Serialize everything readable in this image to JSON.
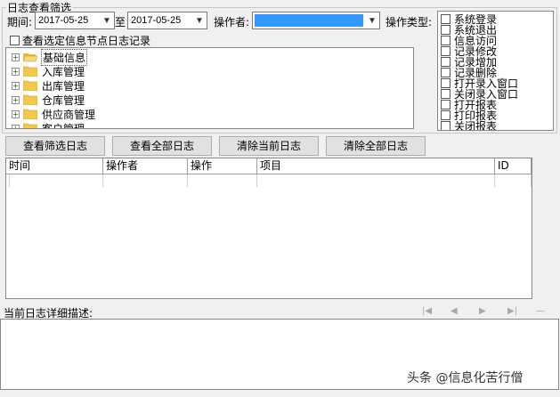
{
  "filter": {
    "group_title": "日志查看筛选",
    "period_label": "期间:",
    "start_date": "2017-05-25",
    "to_label": "至",
    "end_date": "2017-05-25",
    "operator_label": "操作者:",
    "operator_value": "",
    "op_type_label": "操作类型:",
    "node_log_label": "查看选定信息节点日志记录"
  },
  "tree": {
    "items": [
      {
        "label": "基础信息",
        "selected": true
      },
      {
        "label": "入库管理"
      },
      {
        "label": "出库管理"
      },
      {
        "label": "仓库管理"
      },
      {
        "label": "供应商管理"
      },
      {
        "label": "客户管理"
      }
    ]
  },
  "op_types": [
    "系统登录",
    "系统退出",
    "信息访问",
    "记录修改",
    "记录增加",
    "记录删除",
    "打开录入窗口",
    "关闭录入窗口",
    "打开报表",
    "打印报表",
    "关闭报表"
  ],
  "buttons": {
    "view_filtered": "查看筛选日志",
    "view_all": "查看全部日志",
    "clear_current": "清除当前日志",
    "clear_all": "清除全部日志"
  },
  "grid": {
    "columns": [
      "时间",
      "操作者",
      "操作",
      "项目",
      "ID"
    ]
  },
  "detail": {
    "label": "当前日志详细描述:"
  },
  "colors": {
    "operator_highlight": "#3399ff",
    "folder": "#f2c94c"
  },
  "watermark": "头条 @信息化苦行僧"
}
